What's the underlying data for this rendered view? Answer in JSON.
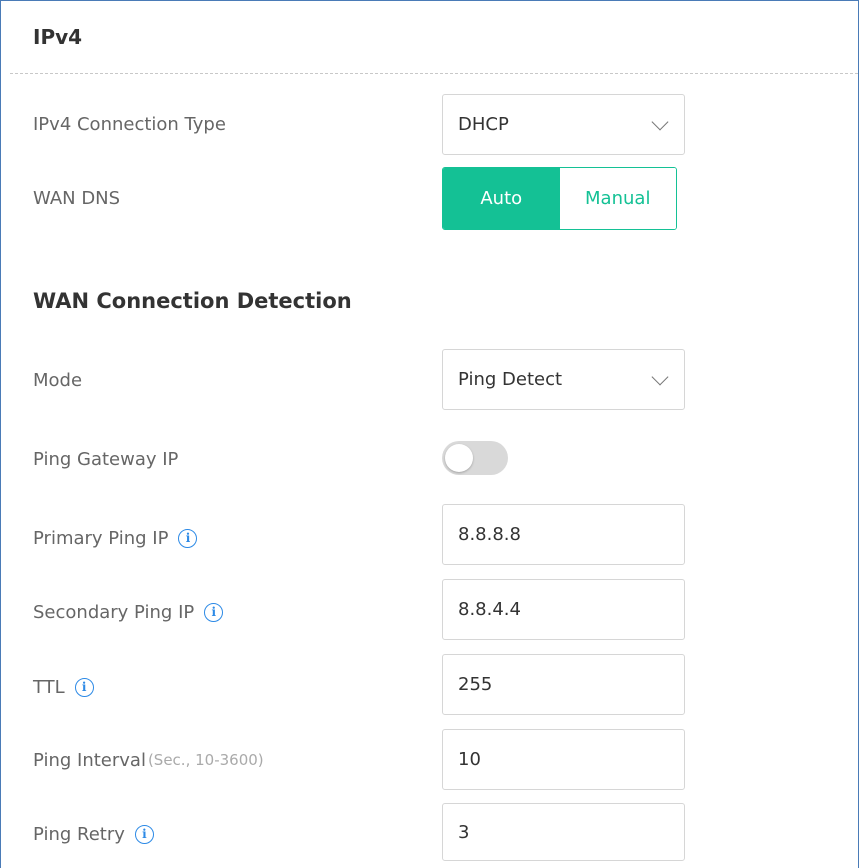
{
  "section": {
    "title": "IPv4"
  },
  "ipv4_connection_type": {
    "label": "IPv4 Connection Type",
    "value": "DHCP"
  },
  "wan_dns": {
    "label": "WAN DNS",
    "options": [
      "Auto",
      "Manual"
    ],
    "selected": "Auto"
  },
  "detection": {
    "title": "WAN Connection Detection",
    "mode": {
      "label": "Mode",
      "value": "Ping Detect"
    },
    "ping_gateway_ip": {
      "label": "Ping Gateway IP",
      "enabled": false
    },
    "primary_ping_ip": {
      "label": "Primary Ping IP",
      "value": "8.8.8.8"
    },
    "secondary_ping_ip": {
      "label": "Secondary Ping IP",
      "value": "8.8.4.4"
    },
    "ttl": {
      "label": "TTL",
      "value": "255"
    },
    "ping_interval": {
      "label": "Ping Interval",
      "hint": "(Sec., 10-3600)",
      "value": "10"
    },
    "ping_retry": {
      "label": "Ping Retry",
      "value": "3"
    }
  },
  "info_glyph": "i",
  "colors": {
    "accent": "#14c195",
    "info": "#2d8ae6",
    "frame": "#4a7bb7"
  }
}
